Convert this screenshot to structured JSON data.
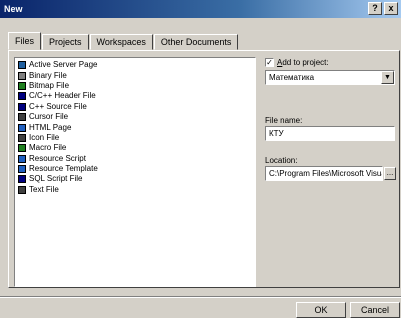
{
  "window": {
    "title": "New",
    "help_btn": "?",
    "close_btn": "x"
  },
  "tabs": [
    {
      "label": "Files",
      "active": true
    },
    {
      "label": "Projects",
      "active": false
    },
    {
      "label": "Workspaces",
      "active": false
    },
    {
      "label": "Other Documents",
      "active": false
    }
  ],
  "file_types": [
    {
      "label": "Active Server Page",
      "icon": "asp-icon",
      "color": "#2060a0"
    },
    {
      "label": "Binary File",
      "icon": "binary-file-icon",
      "color": "#808080"
    },
    {
      "label": "Bitmap File",
      "icon": "bitmap-file-icon",
      "color": "#208020"
    },
    {
      "label": "C/C++ Header File",
      "icon": "header-file-icon",
      "color": "#000080"
    },
    {
      "label": "C++ Source File",
      "icon": "source-file-icon",
      "color": "#000080"
    },
    {
      "label": "Cursor File",
      "icon": "cursor-file-icon",
      "color": "#404040"
    },
    {
      "label": "HTML Page",
      "icon": "html-page-icon",
      "color": "#2060c0"
    },
    {
      "label": "Icon File",
      "icon": "icon-file-icon",
      "color": "#404040"
    },
    {
      "label": "Macro File",
      "icon": "macro-file-icon",
      "color": "#208020"
    },
    {
      "label": "Resource Script",
      "icon": "resource-script-icon",
      "color": "#2060c0"
    },
    {
      "label": "Resource Template",
      "icon": "resource-template-icon",
      "color": "#2060c0"
    },
    {
      "label": "SQL Script File",
      "icon": "sql-file-icon",
      "color": "#000080"
    },
    {
      "label": "Text File",
      "icon": "text-file-icon",
      "color": "#404040"
    }
  ],
  "add_to_project": {
    "label": "Add to project:",
    "checked": true,
    "check_mark": "✓"
  },
  "project_select": {
    "value": "Математика",
    "arrow": "▼"
  },
  "file_name": {
    "label": "File name:",
    "value": "КТУ"
  },
  "location": {
    "label": "Location:",
    "value": "C:\\Program Files\\Microsoft Visua",
    "browse": "..."
  },
  "buttons": {
    "ok": "OK",
    "cancel": "Cancel"
  }
}
